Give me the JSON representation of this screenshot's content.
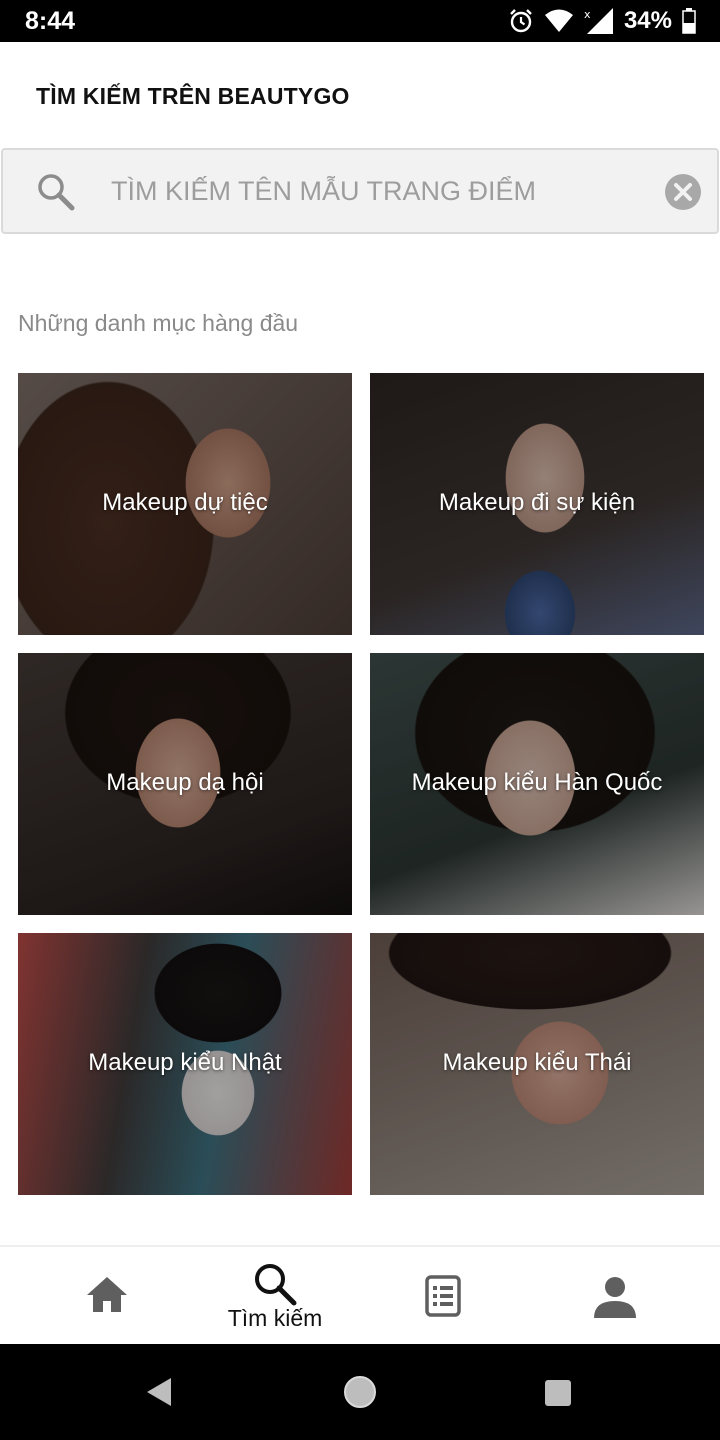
{
  "status_bar": {
    "time": "8:44",
    "battery": "34%",
    "icons": [
      "alarm-icon",
      "wifi-icon",
      "cell-signal-icon",
      "battery-icon"
    ]
  },
  "header": {
    "title": "TÌM KIẾM TRÊN BEAUTYGO"
  },
  "search": {
    "placeholder": "TÌM KIẾM TÊN MẪU TRANG ĐIỂM",
    "value": ""
  },
  "categories": {
    "title": "Những danh mục hàng đầu",
    "items": [
      {
        "label": "Makeup dự tiệc"
      },
      {
        "label": "Makeup đi sự kiện"
      },
      {
        "label": "Makeup dạ hội"
      },
      {
        "label": "Makeup kiểu Hàn Quốc"
      },
      {
        "label": "Makeup kiểu Nhật"
      },
      {
        "label": "Makeup kiểu Thái"
      }
    ]
  },
  "bottom_nav": {
    "items": [
      {
        "icon": "home-icon",
        "label": ""
      },
      {
        "icon": "search-icon",
        "label": "Tìm kiếm",
        "active": true
      },
      {
        "icon": "list-icon",
        "label": ""
      },
      {
        "icon": "account-icon",
        "label": ""
      }
    ]
  },
  "colors": {
    "nav_inactive": "#5f5f5f",
    "nav_active": "#111111",
    "search_bg": "#f2f2f2"
  }
}
